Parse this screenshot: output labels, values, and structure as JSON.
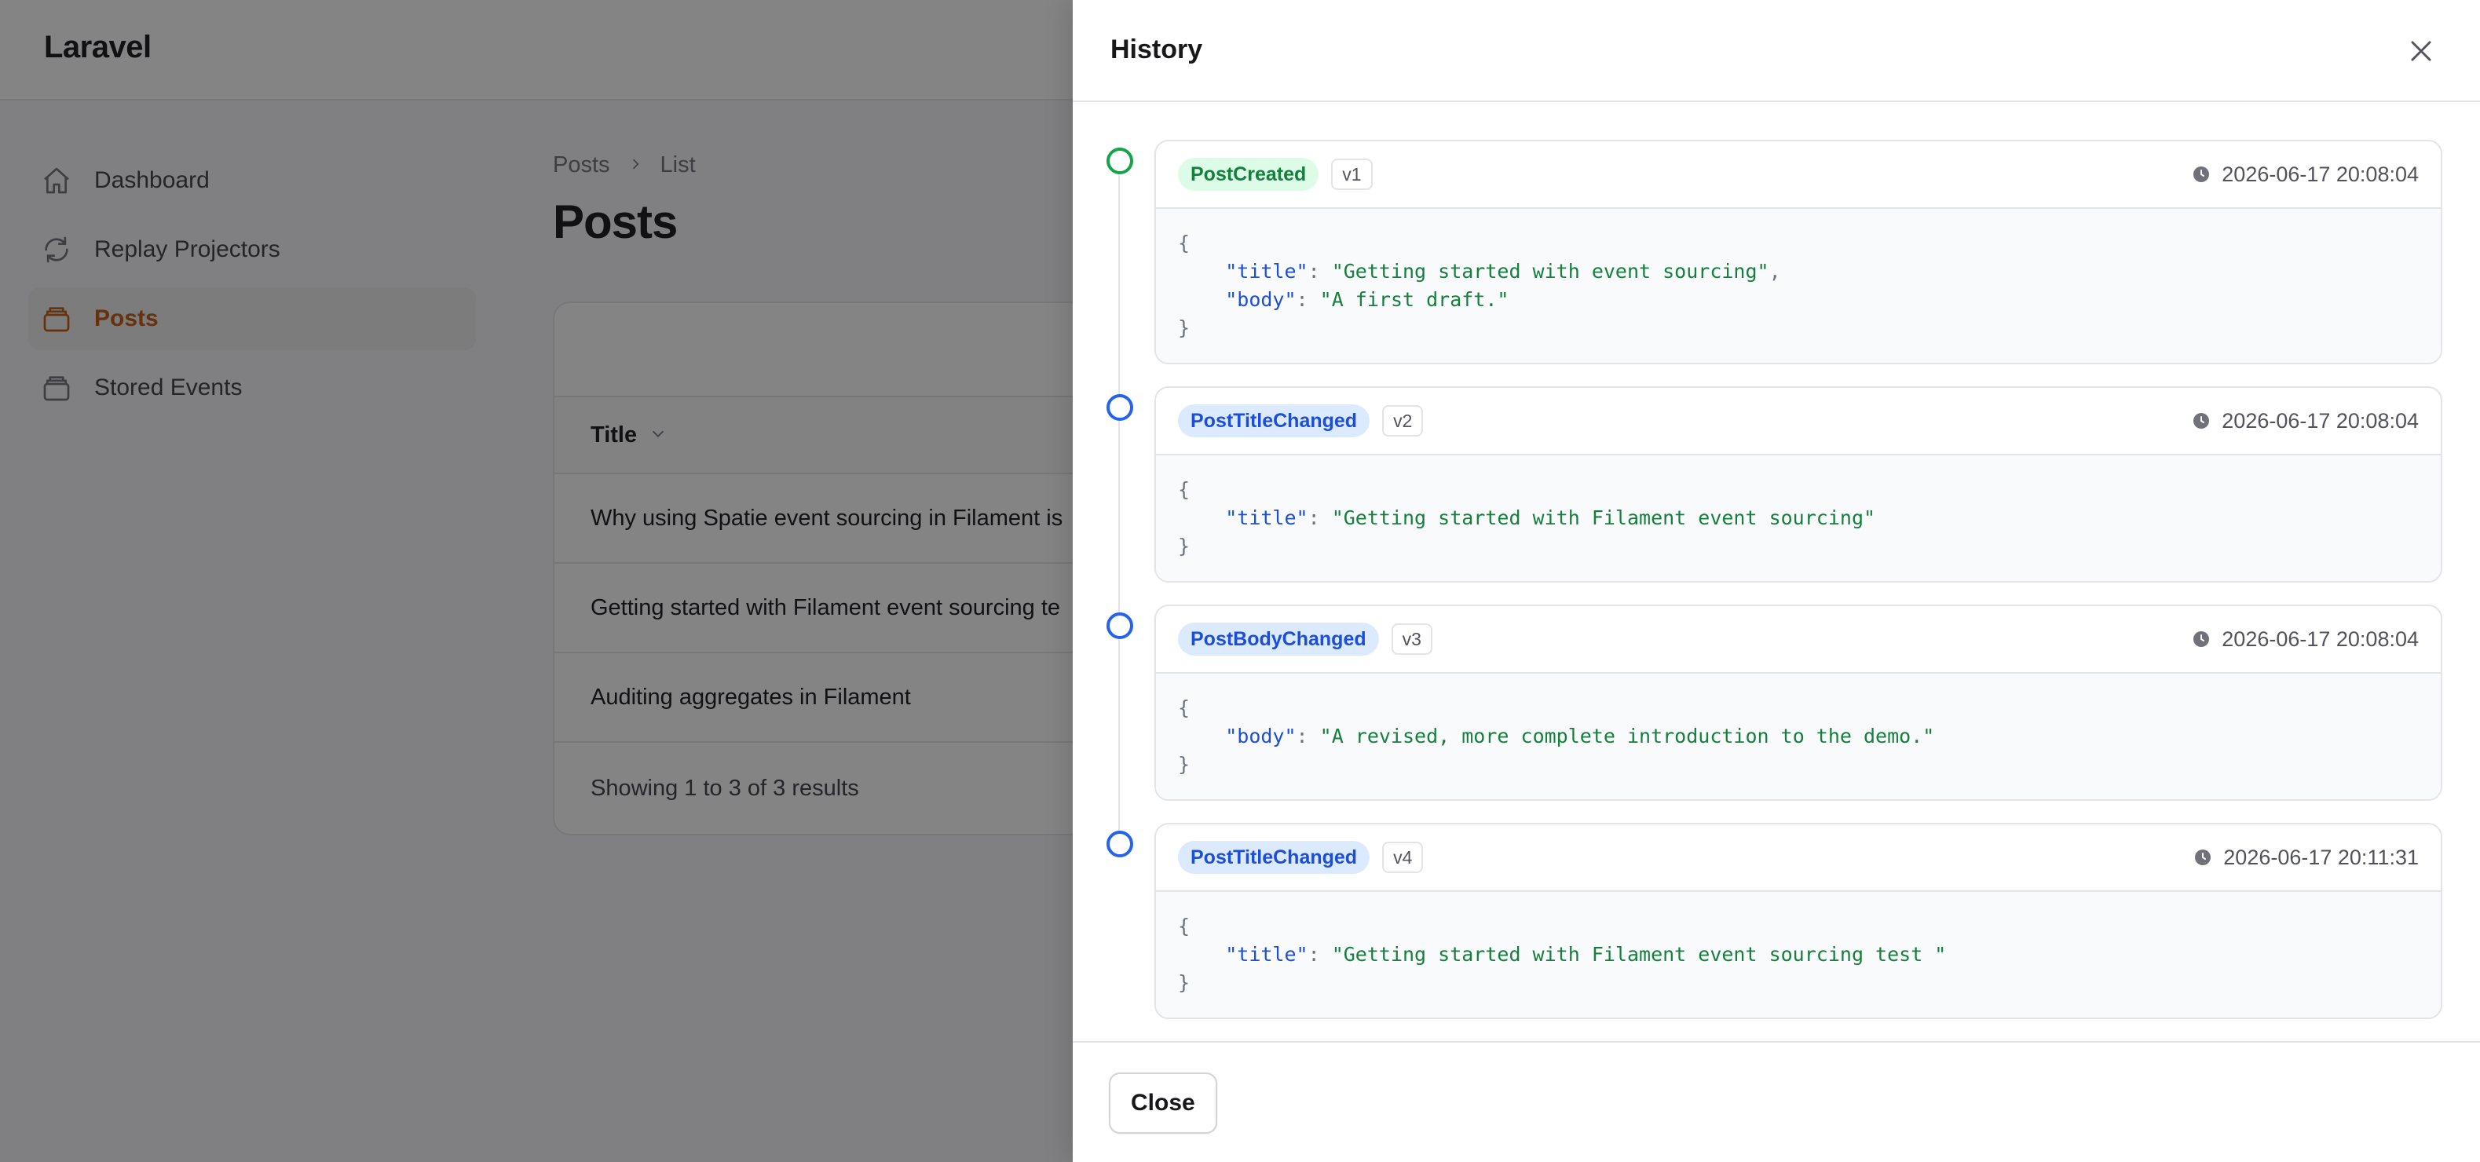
{
  "app": {
    "brand": "Laravel"
  },
  "sidebar": {
    "items": [
      {
        "label": "Dashboard",
        "icon": "home-icon",
        "active": false
      },
      {
        "label": "Replay Projectors",
        "icon": "refresh-icon",
        "active": false
      },
      {
        "label": "Posts",
        "icon": "archive-box-icon",
        "active": true
      },
      {
        "label": "Stored Events",
        "icon": "archive-box-icon",
        "active": false
      }
    ]
  },
  "main": {
    "breadcrumb": [
      "Posts",
      "List"
    ],
    "title": "Posts",
    "table": {
      "column": "Title",
      "rows": [
        "Why using Spatie event sourcing in Filament is",
        "Getting started with Filament event sourcing te",
        "Auditing aggregates in Filament"
      ],
      "footer": "Showing 1 to 3 of 3 results"
    }
  },
  "history": {
    "title": "History",
    "close_label": "Close",
    "events": [
      {
        "name": "PostCreated",
        "version": "v1",
        "timestamp": "2026-06-17 20:08:04",
        "color": "#16a34a",
        "payload": [
          {
            "key": "\"title\"",
            "value": "\"Getting started with event sourcing\"",
            "comma": ","
          },
          {
            "key": "\"body\"",
            "value": "\"A first draft.\"",
            "comma": ""
          }
        ]
      },
      {
        "name": "PostTitleChanged",
        "version": "v2",
        "timestamp": "2026-06-17 20:08:04",
        "color": "#2563eb",
        "payload": [
          {
            "key": "\"title\"",
            "value": "\"Getting started with Filament event sourcing\"",
            "comma": ""
          }
        ]
      },
      {
        "name": "PostBodyChanged",
        "version": "v3",
        "timestamp": "2026-06-17 20:08:04",
        "color": "#2563eb",
        "payload": [
          {
            "key": "\"body\"",
            "value": "\"A revised, more complete introduction to the demo.\"",
            "comma": ""
          }
        ]
      },
      {
        "name": "PostTitleChanged",
        "version": "v4",
        "timestamp": "2026-06-17 20:11:31",
        "color": "#2563eb",
        "payload": [
          {
            "key": "\"title\"",
            "value": "\"Getting started with Filament event sourcing test \"",
            "comma": ""
          }
        ]
      }
    ]
  },
  "json_syntax": {
    "open": "{",
    "close": "}",
    "colon": ": "
  }
}
